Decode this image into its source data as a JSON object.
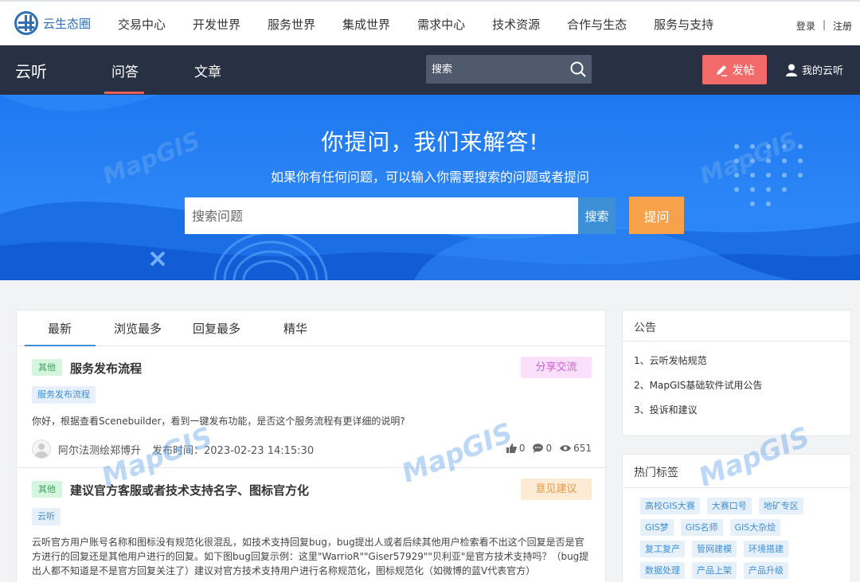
{
  "topnav": {
    "logo_text": "云生态圈",
    "items": [
      "交易中心",
      "开发世界",
      "服务世界",
      "集成世界",
      "需求中心",
      "技术资源",
      "合作与生态",
      "服务与支持"
    ],
    "login": "登录",
    "separator": "|",
    "register": "注册"
  },
  "subnav": {
    "brand": "云听",
    "tabs": [
      "问答",
      "文章"
    ],
    "active_tab": "问答",
    "search_placeholder": "搜索",
    "post_button": "发帖",
    "my_cloud": "我的云听"
  },
  "hero": {
    "title": "你提问，我们来解答!",
    "subtitle": "如果你有任何问题，可以输入你需要搜索的问题或者提问",
    "search_placeholder": "搜索问题",
    "search_button": "搜索",
    "ask_button": "提问"
  },
  "main": {
    "tabs": [
      "最新",
      "浏览最多",
      "回复最多",
      "精华"
    ],
    "active_tab": "最新",
    "posts": [
      {
        "category": "其他",
        "title": "服务发布流程",
        "type": "分享交流",
        "label": "服务发布流程",
        "excerpt": "你好，根据查看Scenebuilder，看到一键发布功能，是否这个服务流程有更详细的说明?",
        "author": "阿尔法测绘郑博升",
        "publish_time": "发布时间：2023-02-23 14:15:30",
        "likes": "0",
        "comments": "0",
        "views": "651"
      },
      {
        "category": "其他",
        "title": "建议官方客服或者技术支持名字、图标官方化",
        "type": "意见建议",
        "label": "云听",
        "excerpt": "云听官方用户账号名称和图标没有规范化很混乱，如技术支持回复bug，bug提出人或者后续其他用户检索看不出这个回复是否是官方进行的回复还是其他用户进行的回复。如下图bug回复示例：这里\"WarrioR\"\"Giser57929\"\"贝利亚\"是官方技术支持吗？（bug提出人都不知道是不是官方回复关注了）建议对官方技术支持用户进行名称规范化，图标规范化（如微博的蓝V代表官方）"
      }
    ]
  },
  "notice": {
    "title": "公告",
    "items": [
      "1、云听发帖规范",
      "2、MapGIS基础软件试用公告",
      "3、投诉和建议"
    ]
  },
  "hot_tags": {
    "title": "热门标签",
    "tags": [
      "高校GIS大赛",
      "大赛口号",
      "地矿专区",
      "GIS梦",
      "GIS名师",
      "GIS大杂烩",
      "复工复产",
      "管网建模",
      "环境搭建",
      "数据处理",
      "产品上架",
      "产品升级"
    ]
  },
  "watermark_text": "MapGIS",
  "colors": {
    "topbar_dark": "#283044",
    "accent_red": "#f36a6a",
    "hero_blue": "#2a84f5",
    "ask_orange": "#f7a24b",
    "link_blue": "#3d8fd6"
  }
}
